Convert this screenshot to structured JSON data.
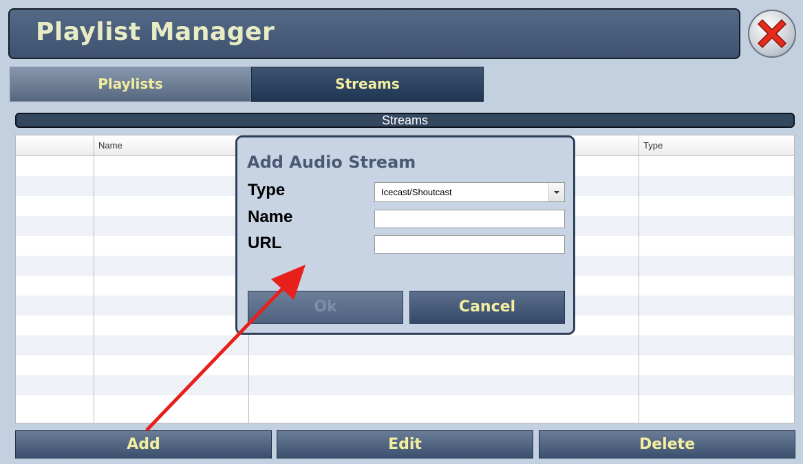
{
  "window": {
    "title": "Playlist Manager",
    "close_icon": "close-x-icon"
  },
  "tabs": [
    {
      "label": "Playlists",
      "active": false
    },
    {
      "label": "Streams",
      "active": true
    }
  ],
  "section": {
    "title": "Streams"
  },
  "table": {
    "columns": [
      "",
      "Name",
      "",
      "Type"
    ],
    "rows": []
  },
  "dialog": {
    "title": "Add Audio Stream",
    "type_label": "Type",
    "type_value": "Icecast/Shoutcast",
    "name_label": "Name",
    "name_value": "",
    "url_label": "URL",
    "url_value": "",
    "ok_label": "Ok",
    "ok_enabled": false,
    "cancel_label": "Cancel"
  },
  "actions": {
    "add_label": "Add",
    "edit_label": "Edit",
    "delete_label": "Delete"
  },
  "colors": {
    "annotation_arrow": "#e8201c",
    "button_text": "#f3eea0",
    "title_text": "#e8ecc4"
  }
}
